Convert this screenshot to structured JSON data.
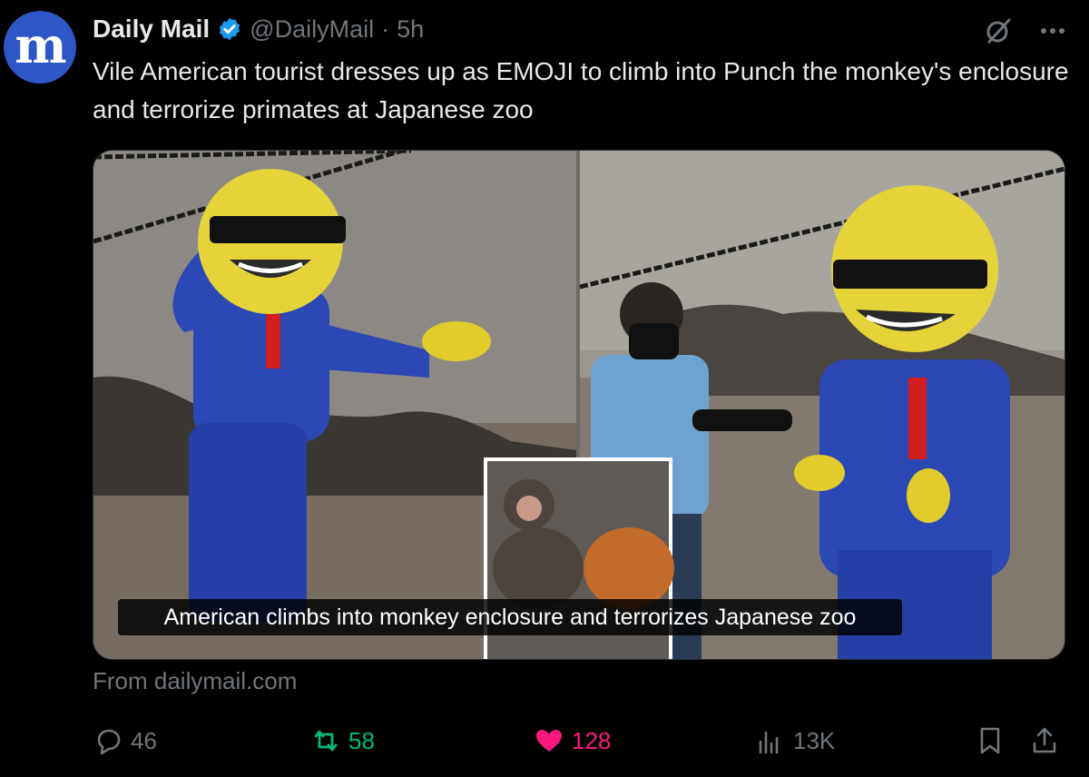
{
  "author": {
    "avatar_letter": "m",
    "name": "Daily Mail",
    "handle": "@DailyMail",
    "separator": "·",
    "time": "5h"
  },
  "tweet": {
    "text": "Vile American tourist dresses up as EMOJI to climb into Punch the monkey's enclosure and terrorize primates at Japanese zoo"
  },
  "media": {
    "caption": "American climbs into monkey enclosure and terrorizes Japanese zoo"
  },
  "source": "From dailymail.com",
  "metrics": {
    "replies": "46",
    "retweets": "58",
    "likes": "128",
    "views": "13K"
  },
  "icons": [
    "verified-badge-icon",
    "grok-icon",
    "more-icon",
    "reply-icon",
    "retweet-icon",
    "like-icon",
    "views-icon",
    "bookmark-icon",
    "share-icon"
  ],
  "colors": {
    "background": "#000000",
    "text": "#e7e9ea",
    "muted": "#71767b",
    "verified": "#1d9bf0",
    "retweet_active": "#00ba7c",
    "like_active": "#f91880",
    "avatar_bg": "#2f56c6"
  }
}
